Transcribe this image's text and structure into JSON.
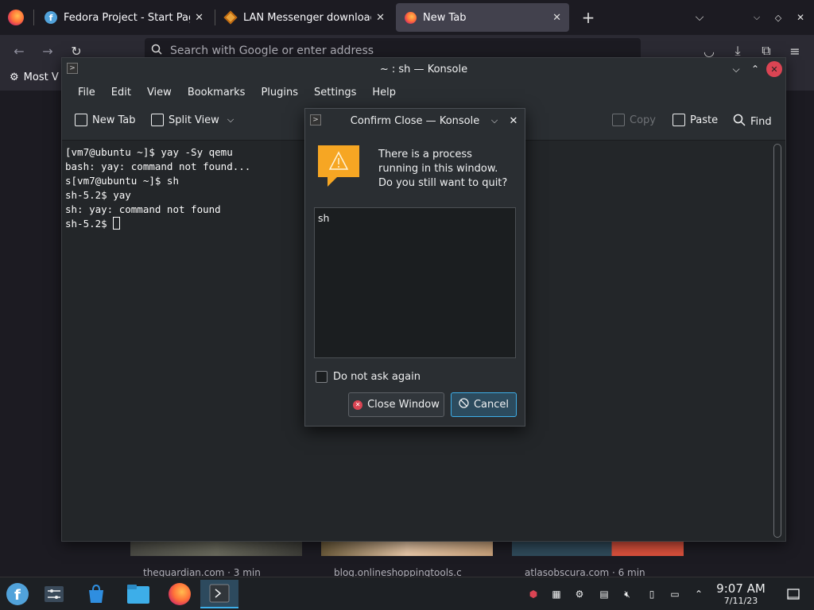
{
  "firefox": {
    "tabs": [
      {
        "label": "Fedora Project - Start Page",
        "close": "✕"
      },
      {
        "label": "LAN Messenger download",
        "close": "✕"
      },
      {
        "label": "New Tab",
        "close": "✕"
      }
    ],
    "new_tab": "+",
    "urlbar_placeholder": "Search with Google or enter address",
    "bookmark_label": "Most V",
    "tiles": [
      {
        "title": "theguardian.com · 3 min"
      },
      {
        "title": "blog.onlineshoppingtools.c"
      },
      {
        "title": "atlasobscura.com · 6 min"
      }
    ]
  },
  "konsole": {
    "title": "~ : sh — Konsole",
    "menu": [
      "File",
      "Edit",
      "View",
      "Bookmarks",
      "Plugins",
      "Settings",
      "Help"
    ],
    "toolbar": {
      "new_tab": "New Tab",
      "split_view": "Split View",
      "copy": "Copy",
      "paste": "Paste",
      "find": "Find"
    },
    "terminal_lines": [
      "[vm7@ubuntu ~]$ yay -Sy qemu",
      "bash: yay: command not found...",
      "s[vm7@ubuntu ~]$ sh",
      "sh-5.2$ yay",
      "sh: yay: command not found",
      "sh-5.2$ "
    ]
  },
  "dialog": {
    "title": "Confirm Close — Konsole",
    "message": "There is a process running in this window. Do you still want to quit?",
    "processes": [
      "sh"
    ],
    "checkbox_label": "Do not ask again",
    "checkbox_checked": false,
    "close_button": "Close Window",
    "cancel_button": "Cancel"
  },
  "taskbar": {
    "time": "9:07 AM",
    "date": "7/11/23"
  },
  "colors": {
    "accent": "#3daee9",
    "close_red": "#da4453",
    "warning": "#f6a623"
  }
}
